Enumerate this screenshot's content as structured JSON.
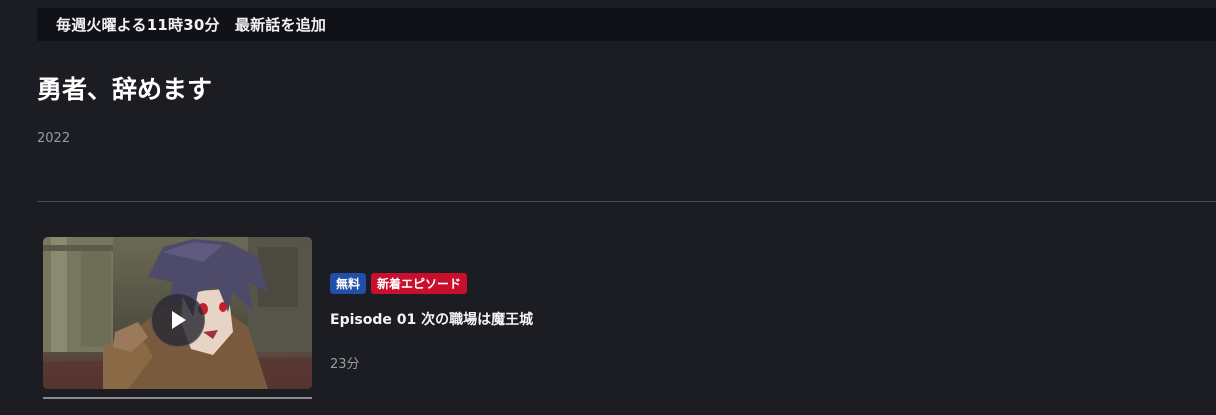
{
  "notice": {
    "text": "毎週火曜よる11時30分　最新話を追加"
  },
  "series": {
    "title": "勇者、辞めます",
    "year": "2022"
  },
  "episodes": [
    {
      "badges": {
        "free": "無料",
        "new": "新着エピソード"
      },
      "title": "Episode 01 次の職場は魔王城",
      "duration": "23分",
      "progress": 0
    }
  ],
  "colors": {
    "background": "#1c1d22",
    "banner": "#111217",
    "badge_free": "#1f4fa8",
    "badge_new": "#c8102e",
    "muted_text": "#9a9ba0"
  },
  "icons": {
    "play": "play-icon"
  }
}
